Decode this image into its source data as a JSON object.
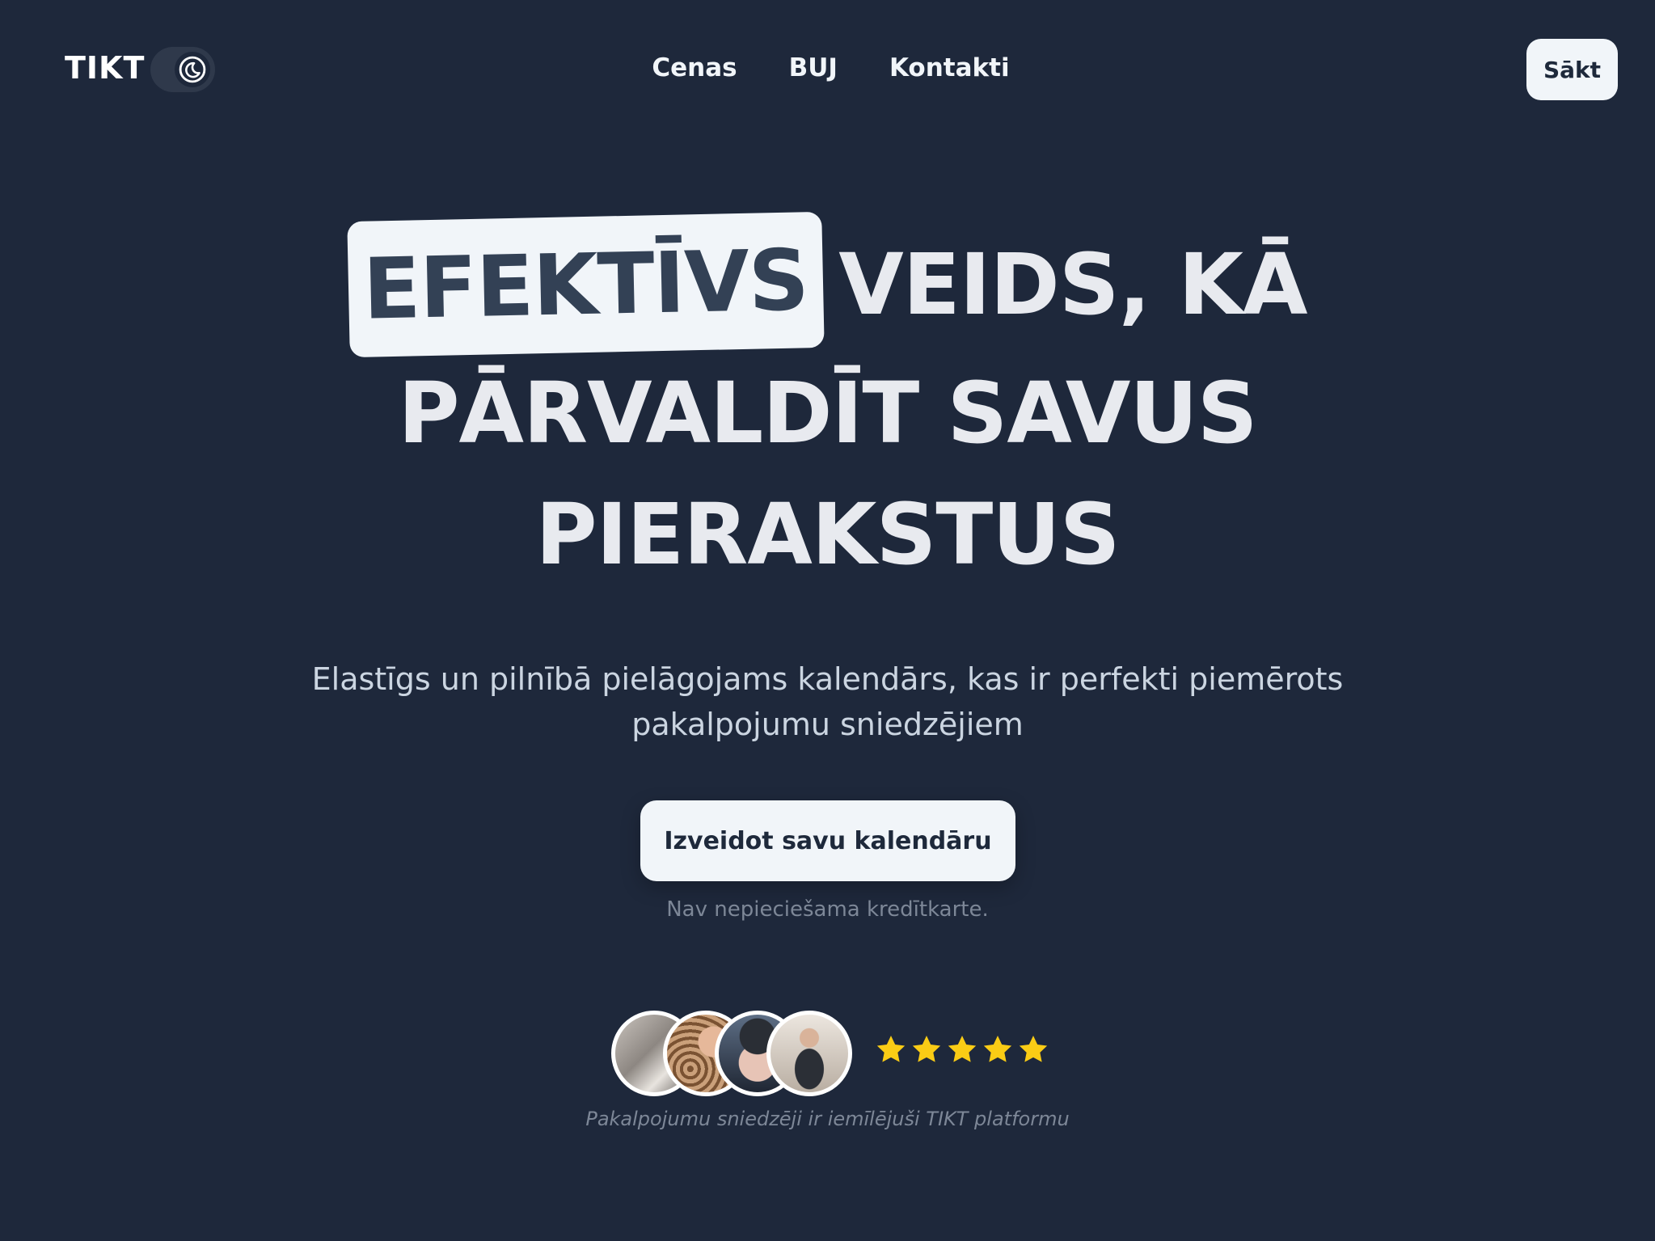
{
  "header": {
    "logo": "TIKT",
    "nav": [
      "Cenas",
      "BUJ",
      "Kontakti"
    ],
    "start_label": "Sākt",
    "theme_icon": "moon-icon"
  },
  "hero": {
    "highlight": "EFEKTĪVS",
    "line1_rest": "VEIDS, KĀ",
    "line2": "PĀRVALDĪT SAVUS",
    "line3": "PIERAKSTUS",
    "subtitle": "Elastīgs un pilnībā pielāgojams kalendārs, kas ir perfekti piemērots pakalpojumu sniedzējiem",
    "cta_label": "Izveidot savu kalendāru",
    "note": "Nav nepieciešama kredītkarte."
  },
  "social_proof": {
    "rating": 5,
    "rating_max": 5,
    "text": "Pakalpojumu sniedzēji ir iemīlējuši TIKT platformu"
  },
  "colors": {
    "background": "#1e283b",
    "text_light": "#f1f5f9",
    "highlight_text": "#334155",
    "star": "#facc15"
  }
}
